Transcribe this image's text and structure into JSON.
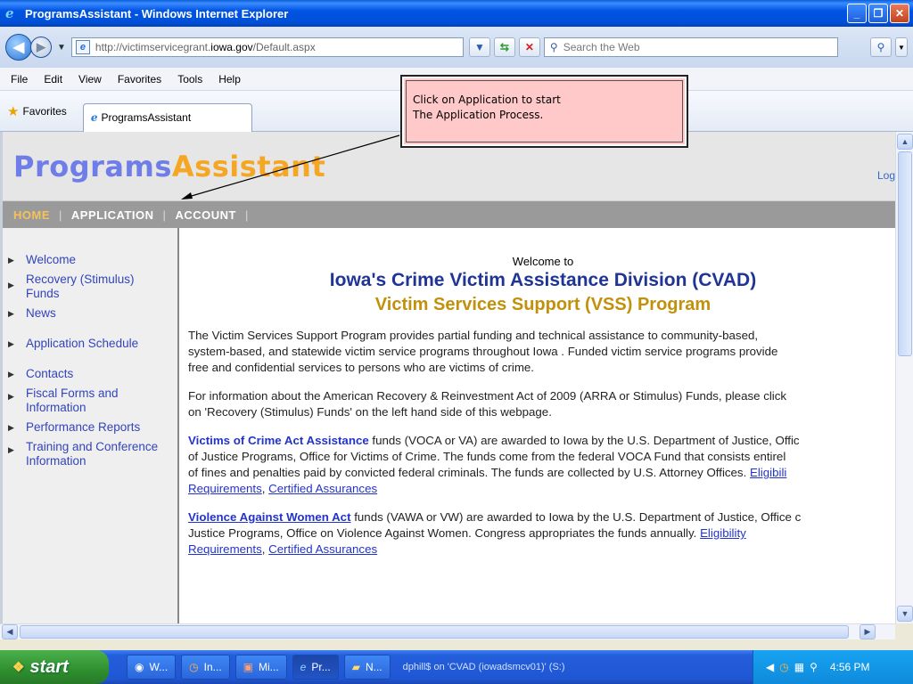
{
  "window": {
    "title": "ProgramsAssistant - Windows Internet Explorer",
    "icon": "ie-icon",
    "buttons": [
      "minimize",
      "restore",
      "close"
    ]
  },
  "address_bar": {
    "url_prefix": "http://victimservicegrant.",
    "url_domain": "iowa.gov",
    "url_suffix": "/Default.aspx",
    "search_placeholder": "Search the Web"
  },
  "menu": [
    "File",
    "Edit",
    "View",
    "Favorites",
    "Tools",
    "Help"
  ],
  "favorites": {
    "label": "Favorites",
    "tab_title": "ProgramsAssistant"
  },
  "callout": {
    "line1": "Click on  Application to start",
    "line2": "The Application Process."
  },
  "site": {
    "logo_part1": "Programs",
    "logo_part2": "Assistant",
    "login_link": "Log",
    "nav": [
      "HOME",
      "APPLICATION",
      "ACCOUNT"
    ],
    "nav_active": "HOME"
  },
  "sidebar": {
    "items": [
      {
        "label": "Welcome"
      },
      {
        "label": "Recovery (Stimulus) Funds"
      },
      {
        "label": "News"
      },
      {
        "label": "Application Schedule"
      },
      {
        "label": "Contacts"
      },
      {
        "label": "Fiscal Forms and Information"
      },
      {
        "label": "Performance Reports"
      },
      {
        "label": "Training and Conference Information"
      }
    ]
  },
  "main": {
    "welcome_to": "Welcome to",
    "heading1": "Iowa's Crime Victim Assistance Division (CVAD)",
    "heading2": "Victim Services Support (VSS) Program",
    "p1_l1": "The Victim Services Support Program provides partial funding and technical assistance to community-based,",
    "p1_l2": "system-based, and statewide victim service programs throughout Iowa .  Funded victim service programs provide",
    "p1_l3": "free and confidential services to persons who are victims of crime.",
    "p2_l1": "For information about the American Recovery & Reinvestment Act of 2009 (ARRA or Stimulus) Funds, please click",
    "p2_l2": "on 'Recovery (Stimulus) Funds' on the left hand side of this webpage.",
    "p3_link": "Victims of Crime Act Assistance",
    "p3_l1": " funds (VOCA or VA) are awarded to Iowa by the U.S. Department of Justice, Offic",
    "p3_l2": "of Justice Programs, Office for Victims of Crime. The funds come from the federal VOCA Fund that consists entirel",
    "p3_l3": "of fines and penalties paid by convicted federal criminals. The funds are collected by U.S. Attorney Offices. ",
    "p3_link_elig": "Eligibili",
    "p3_link_req": "Requirements",
    "p3_link_cert": "Certified Assurances",
    "p4_link": "Violence Against Women Act",
    "p4_l1": " funds (VAWA or VW) are awarded to Iowa by the U.S. Department of Justice, Office c",
    "p4_l2": "Justice Programs, Office on Violence Against Women. Congress appropriates the funds annually. ",
    "p4_link_elig": "Eligibility",
    "p4_link_req": "Requirements",
    "p4_link_cert": "Certified Assurances",
    "comma": ", "
  },
  "taskbar": {
    "start": "start",
    "tasks": [
      {
        "icon": "media-icon",
        "label": "W..."
      },
      {
        "icon": "clock-icon",
        "label": "In..."
      },
      {
        "icon": "outlook-icon",
        "label": "Mi..."
      },
      {
        "icon": "ie-icon",
        "label": "Pr..."
      },
      {
        "icon": "folder-icon",
        "label": "N..."
      }
    ],
    "drive_label": "dphill$ on 'CVAD (iowadsmcv01)' (S:)",
    "clock": "4:56 PM"
  }
}
